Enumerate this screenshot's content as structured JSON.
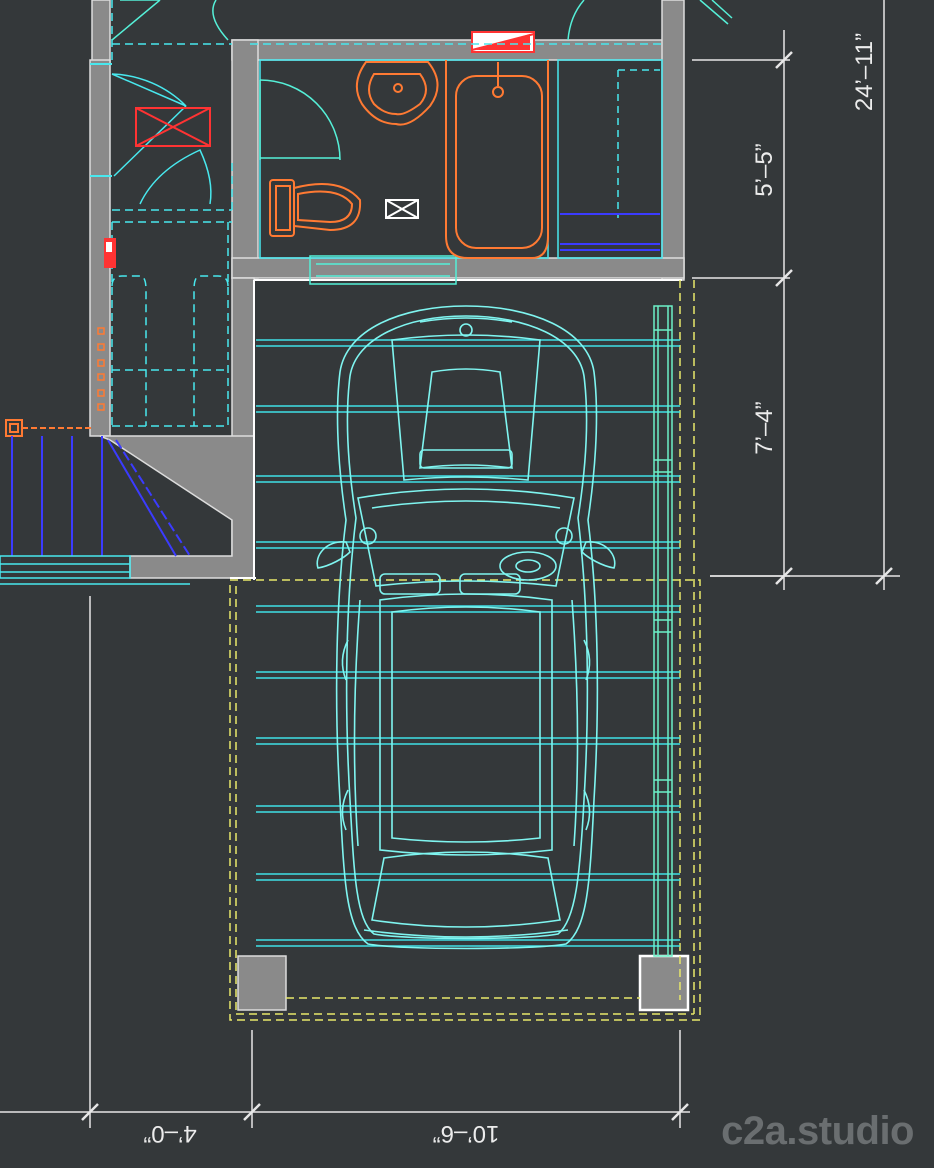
{
  "drawing": {
    "type": "floor-plan",
    "subject": "bathroom and single-car garage",
    "background_color": "#34383a",
    "colors": {
      "wall": "#8a8a8a",
      "outline": "#5ff0f0",
      "fixture": "#ff7a33",
      "accent": "#ff3333",
      "stair": "#3b3bff",
      "dashed_yellow": "#e8e86a",
      "dimension": "#e6e6e6",
      "car": "#7ff5f0"
    }
  },
  "dimensions": {
    "vertical": {
      "bathroom_depth": "5’–5”",
      "garage_segment": "7’–4”",
      "overall": "24’–11”"
    },
    "horizontal": {
      "left_segment": "4’–0”",
      "garage_width": "10’–6”"
    }
  },
  "branding": {
    "watermark": "c2a.studio"
  }
}
